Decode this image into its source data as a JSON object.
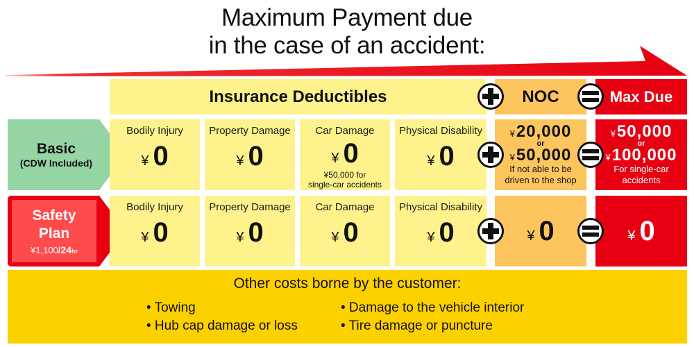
{
  "title": {
    "line1": "Maximum Payment due",
    "line2": "in the case of an accident:"
  },
  "colors": {
    "deductible_yellow": "#fdf28b",
    "noc_orange": "#fdc55e",
    "max_red": "#e60012",
    "basic_green": "#95d5a3",
    "safety_red": "#ff4b4b",
    "other_costs_yellow": "#fdd000"
  },
  "headers": {
    "deductibles": "Insurance Deductibles",
    "noc": "NOC",
    "max_due": "Max Due"
  },
  "operators": {
    "plus": "+",
    "equals": "="
  },
  "plans": {
    "basic": {
      "name": "Basic",
      "sub": "(CDW Included)",
      "cells": [
        {
          "label": "Bodily Injury",
          "yen": "¥",
          "value": "0",
          "note": ""
        },
        {
          "label": "Property Damage",
          "yen": "¥",
          "value": "0",
          "note": ""
        },
        {
          "label": "Car Damage",
          "yen": "¥",
          "value": "0",
          "note_line1": "¥50,000 for",
          "note_line2": "single-car accidents"
        },
        {
          "label": "Physical Disability",
          "yen": "¥",
          "value": "0",
          "note": ""
        }
      ],
      "noc": {
        "yen": "¥",
        "value1": "20,000",
        "or": "or",
        "value2": "50,000",
        "note_line1": "If not able to be",
        "note_line2": "driven to the shop"
      },
      "max_due": {
        "yen": "¥",
        "value1": "50,000",
        "or": "or",
        "value2": "100,000",
        "note_line1": "For single-car",
        "note_line2": "accidents"
      }
    },
    "safety": {
      "name_line1": "Safety",
      "name_line2": "Plan",
      "price": "¥1,100",
      "per": "/",
      "period": "24",
      "period_unit": "hr",
      "cells": [
        {
          "label": "Bodily Injury",
          "yen": "¥",
          "value": "0"
        },
        {
          "label": "Property Damage",
          "yen": "¥",
          "value": "0"
        },
        {
          "label": "Car Damage",
          "yen": "¥",
          "value": "0"
        },
        {
          "label": "Physical Disability",
          "yen": "¥",
          "value": "0"
        }
      ],
      "noc": {
        "yen": "¥",
        "value": "0"
      },
      "max_due": {
        "yen": "¥",
        "value": "0"
      }
    }
  },
  "other_costs": {
    "title": "Other costs borne by the customer:",
    "left": [
      "• Towing",
      "• Hub cap damage or loss"
    ],
    "right": [
      "• Damage to the vehicle interior",
      "• Tire damage or puncture"
    ]
  }
}
